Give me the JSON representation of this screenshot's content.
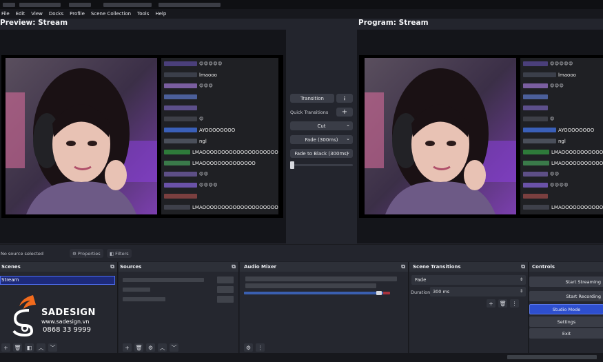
{
  "menu": [
    "File",
    "Edit",
    "View",
    "Docks",
    "Profile",
    "Scene Collection",
    "Tools",
    "Help"
  ],
  "preview": {
    "title": "Preview: Stream"
  },
  "program": {
    "title": "Program: Stream"
  },
  "chat": [
    {
      "name_color": "#4a3f7a",
      "text": "",
      "emojis": "😍😍😍😍😍"
    },
    {
      "name_color": "#3b3f4a",
      "text": "lmaooo",
      "emojis": ""
    },
    {
      "name_color": "#7a5ea0",
      "text": "",
      "emojis": "😍😍😍"
    },
    {
      "name_color": "#4b5f9a",
      "text": "",
      "emojis": ""
    },
    {
      "name_color": "#5c4f8a",
      "text": "",
      "emojis": ""
    },
    {
      "name_color": "#3d3f47",
      "text": "",
      "emojis": "😍"
    },
    {
      "name_color": "#3a5fb8",
      "text": "AYOOOOOOOO",
      "emojis": ""
    },
    {
      "name_color": "#4a4f5a",
      "text": "ngl",
      "emojis": ""
    },
    {
      "name_color": "#2e7a3a",
      "text": "LMAOOOOOOOOOOOOOOOOOOOO",
      "emojis": ""
    },
    {
      "name_color": "#3a7a4a",
      "text": "LMAOOOOOOOOOOOOOO",
      "emojis": ""
    },
    {
      "name_color": "#5d4f86",
      "text": "",
      "emojis": "😍😍"
    },
    {
      "name_color": "#6a52a8",
      "text": "",
      "emojis": "😍😍😍😍"
    },
    {
      "name_color": "#7a3f3f",
      "text": "",
      "emojis": ""
    },
    {
      "name_color": "#3e404a",
      "text": "LMAOOOOOOOOOOOOOOOOOOOOOO",
      "emojis": ""
    }
  ],
  "transitions_panel": {
    "transition_label": "Transition",
    "more_label": "⋮",
    "quick_transitions_label": "Quick Transitions",
    "add_label": "+",
    "options": [
      "Cut",
      "Fade (300ms)",
      "Fade to Black (300ms)"
    ]
  },
  "sourcebar": {
    "status": "No source selected",
    "properties": "Properties",
    "filters": "Filters"
  },
  "scenes": {
    "title": "Scenes",
    "items": [
      "Stream"
    ]
  },
  "sources": {
    "title": "Sources"
  },
  "audio_mixer": {
    "title": "Audio Mixer"
  },
  "scene_transitions": {
    "title": "Scene Transitions",
    "selected": "Fade",
    "duration_label": "Duration",
    "duration_value": "300 ms"
  },
  "controls": {
    "title": "Controls",
    "buttons": [
      "Start Streaming",
      "Start Recording",
      "Studio Mode",
      "Settings",
      "Exit"
    ]
  },
  "logo": {
    "brand": "SADESIGN",
    "website": "www.sadesign.vn",
    "phone": "0868 33 9999"
  },
  "colors": {
    "accent": "#3f5fd6",
    "studio_mode_active": "#2e4fcf",
    "logo_orange": "#f26b1d"
  },
  "icons": [
    "plus-icon",
    "trash-icon",
    "filter-icon",
    "chevron-up-icon",
    "chevron-down-icon",
    "gear-icon",
    "more-icon",
    "popout-icon"
  ]
}
